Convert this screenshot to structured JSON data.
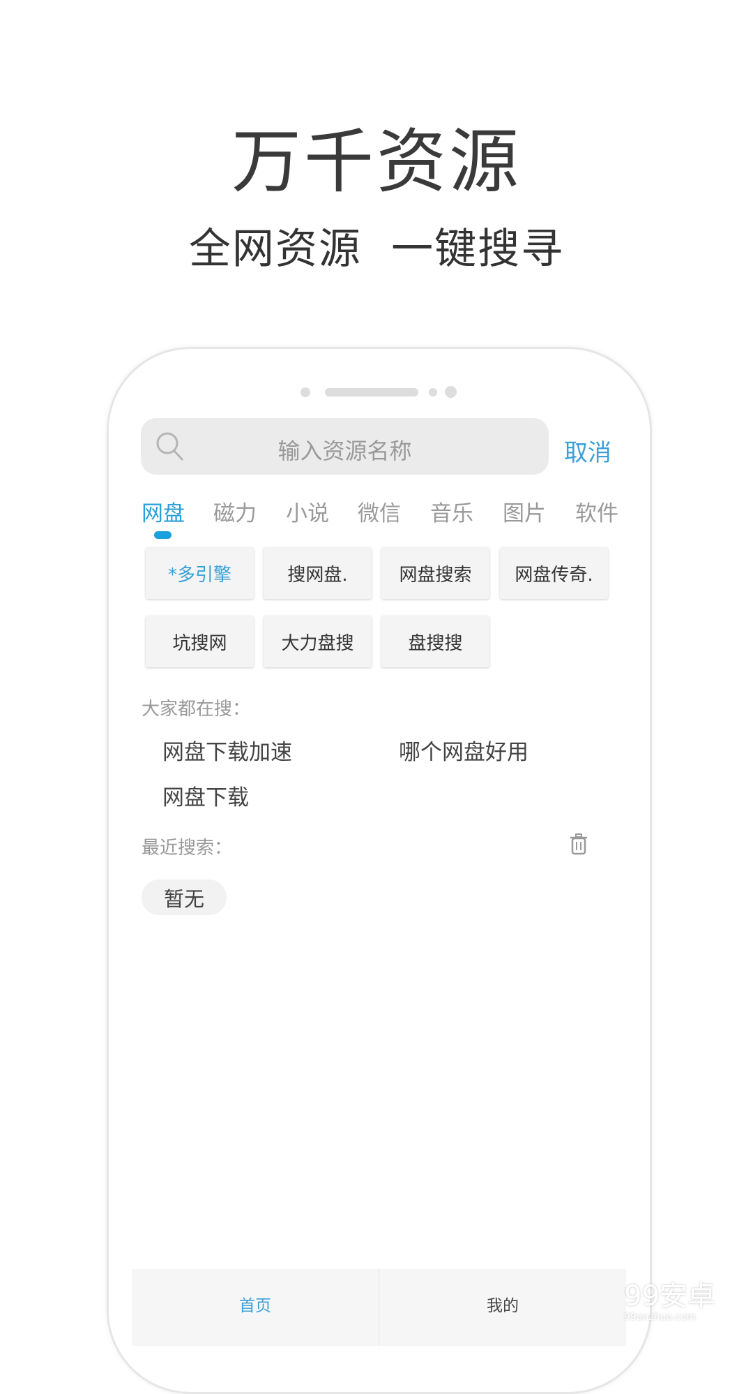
{
  "promo": {
    "title": "万千资源",
    "subtitle": "全网资源  一键搜寻"
  },
  "search": {
    "placeholder": "输入资源名称",
    "cancel_label": "取消"
  },
  "tabs": [
    {
      "label": "网盘",
      "active": true
    },
    {
      "label": "磁力"
    },
    {
      "label": "小说"
    },
    {
      "label": "微信"
    },
    {
      "label": "音乐"
    },
    {
      "label": "图片"
    },
    {
      "label": "软件"
    }
  ],
  "engines": [
    "*多引擎",
    "搜网盘.",
    "网盘搜索",
    "网盘传奇.",
    "坑搜网",
    "大力盘搜",
    "盘搜搜"
  ],
  "hot": {
    "label": "大家都在搜：",
    "items": [
      "网盘下载加速",
      "哪个网盘好用",
      "网盘下载"
    ]
  },
  "recent": {
    "label": "最近搜索：",
    "empty": "暂无"
  },
  "bottom_nav": [
    {
      "label": "首页",
      "active": true
    },
    {
      "label": "我的"
    }
  ],
  "watermark": {
    "brand": "99安卓",
    "url": "99anzhuo.com"
  },
  "colors": {
    "accent": "#2a9fd8"
  }
}
